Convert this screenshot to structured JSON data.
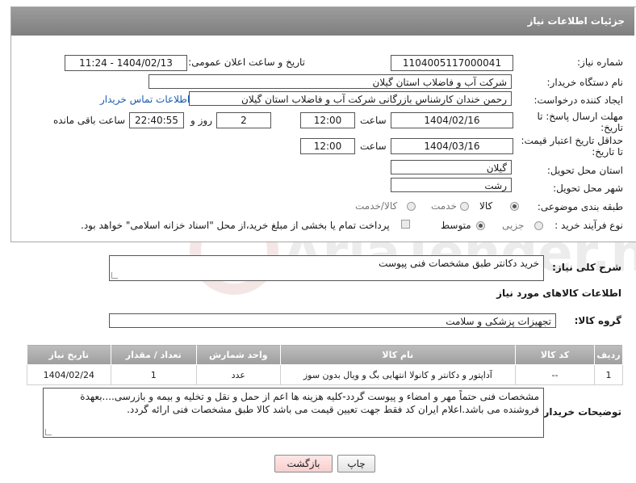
{
  "window": {
    "title": "جزئیات اطلاعات نیاز"
  },
  "fields": {
    "need_number_label": "شماره نیاز:",
    "need_number": "1104005117000041",
    "announce_label": "تاریخ و ساعت اعلان عمومی:",
    "announce_value": "1404/02/13 - 11:24",
    "buyer_org_label": "نام دستگاه خریدار:",
    "buyer_org": "شرکت آب و فاضلاب استان گیلان",
    "creator_label": "ایجاد کننده درخواست:",
    "creator": "رحمن خندان کارشناس بازرگانی شرکت آب و فاضلاب استان گیلان",
    "contact_link": "اطلاعات تماس خریدار",
    "deadline_label_1": "مهلت ارسال پاسخ: تا",
    "deadline_label_2": "تاریخ:",
    "deadline_date": "1404/02/16",
    "time_label": "ساعت",
    "deadline_time": "12:00",
    "days_value": "2",
    "days_label": "روز و",
    "remaining_time": "22:40:55",
    "remaining_label": "ساعت باقی مانده",
    "min_validity_label_1": "حداقل تاریخ اعتبار قیمت:",
    "min_validity_label_2": "تا تاریخ:",
    "validity_date": "1404/03/16",
    "validity_time_label": "ساعت",
    "validity_time": "12:00",
    "province_label": "استان محل تحویل:",
    "province": "گیلان",
    "city_label": "شهر محل تحویل:",
    "city": "رشت",
    "category_label": "طبقه بندی موضوعی:",
    "category_options": [
      "کالا",
      "خدمت",
      "کالا/خدمت"
    ],
    "category_selected": "کالا",
    "process_label": "نوع فرآیند خرید :",
    "process_options": [
      "جزیی",
      "متوسط"
    ],
    "process_selected": "متوسط",
    "payment_note": "پرداخت تمام یا بخشی از مبلغ خرید،از محل \"اسناد خزانه اسلامی\" خواهد بود.",
    "summary_label": "شرح کلی نیاز:",
    "summary": "خرید دکانتر طبق مشخصات فنی پیوست",
    "goods_info_title": "اطلاعات کالاهای مورد نیاز",
    "goods_group_label": "گروه کالا:",
    "goods_group": "تجهیزات پزشکی و سلامت",
    "buyer_notes_label": "توضیحات خریدار:",
    "buyer_notes": "مشخصات فنی حتماً مهر و امضاء و پیوست گردد-کلیه هزینه ها اعم از حمل و نقل و تخلیه و بیمه و بازرسی....بعهدة فروشنده می باشد.اعلام ایران کد فقط جهت تعیین قیمت می باشد کالا طبق مشخصات فنی ارائه گردد."
  },
  "table": {
    "headers": [
      "ردیف",
      "کد کالا",
      "نام کالا",
      "واحد شمارش",
      "تعداد / مقدار",
      "تاریخ نیاز"
    ],
    "rows": [
      [
        "1",
        "--",
        "آداپتور و دکانتر و کانولا انتهایی بگ و ویال بدون سوز",
        "عدد",
        "1",
        "1404/02/24"
      ]
    ]
  },
  "buttons": {
    "print": "چاپ",
    "back": "بازگشت"
  },
  "watermark": "AriaTender.net",
  "colors": {
    "header_bg": "#8c8c8c",
    "link": "#1a5cb0",
    "back_button": "#f7cfcf"
  }
}
